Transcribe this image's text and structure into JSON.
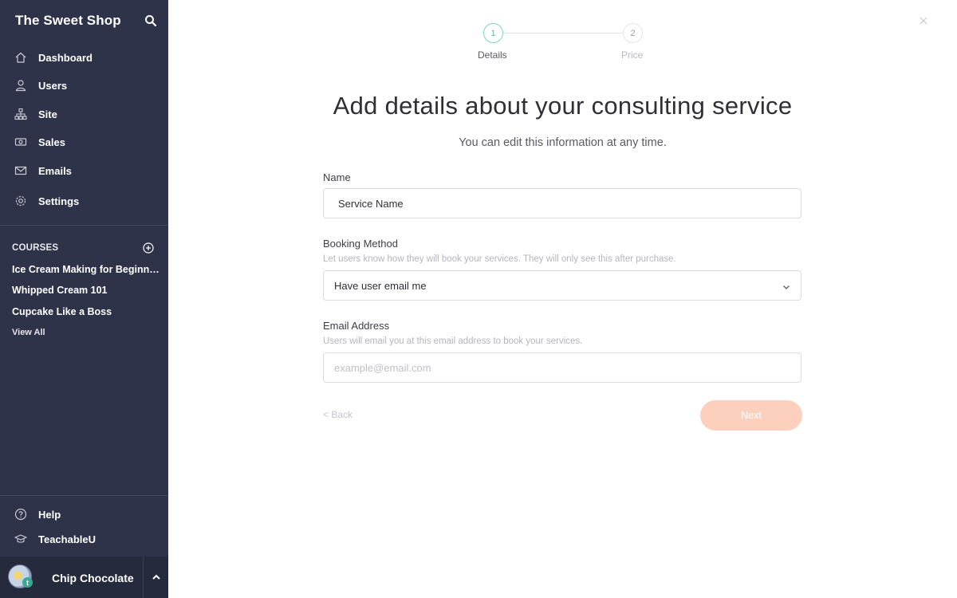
{
  "sidebar": {
    "brand": "The Sweet Shop",
    "nav": [
      {
        "label": "Dashboard",
        "icon": "home-icon"
      },
      {
        "label": "Users",
        "icon": "user-icon"
      },
      {
        "label": "Site",
        "icon": "sitemap-icon"
      },
      {
        "label": "Sales",
        "icon": "money-icon"
      },
      {
        "label": "Emails",
        "icon": "mail-icon"
      },
      {
        "label": "Settings",
        "icon": "gear-icon"
      }
    ],
    "courses_heading": "COURSES",
    "courses": [
      "Ice Cream Making for Beginners",
      "Whipped Cream 101",
      "Cupcake Like a Boss"
    ],
    "view_all": "View All",
    "footer": [
      {
        "label": "Help",
        "icon": "help-icon"
      },
      {
        "label": "TeachableU",
        "icon": "graduation-cap-icon"
      }
    ],
    "user": {
      "name": "Chip Chocolate",
      "badge": "t"
    }
  },
  "stepper": {
    "steps": [
      {
        "number": "1",
        "label": "Details",
        "state": "active"
      },
      {
        "number": "2",
        "label": "Price",
        "state": "inactive"
      }
    ]
  },
  "main": {
    "title": "Add details about your consulting service",
    "subtitle": "You can edit this information at any time.",
    "name_field": {
      "label": "Name",
      "value": "Service Name"
    },
    "booking_field": {
      "label": "Booking Method",
      "help": "Let users know how they will book your services. They will only see this after purchase.",
      "selected": "Have user email me"
    },
    "email_field": {
      "label": "Email Address",
      "help": "Users will email you at this email address to book your services.",
      "placeholder": "example@email.com"
    },
    "back_label": "< Back",
    "next_label": "Next"
  },
  "colors": {
    "sidebar_bg": "#2f3349",
    "accent_green": "#7fd4bf",
    "next_button": "#fcd0bd"
  }
}
